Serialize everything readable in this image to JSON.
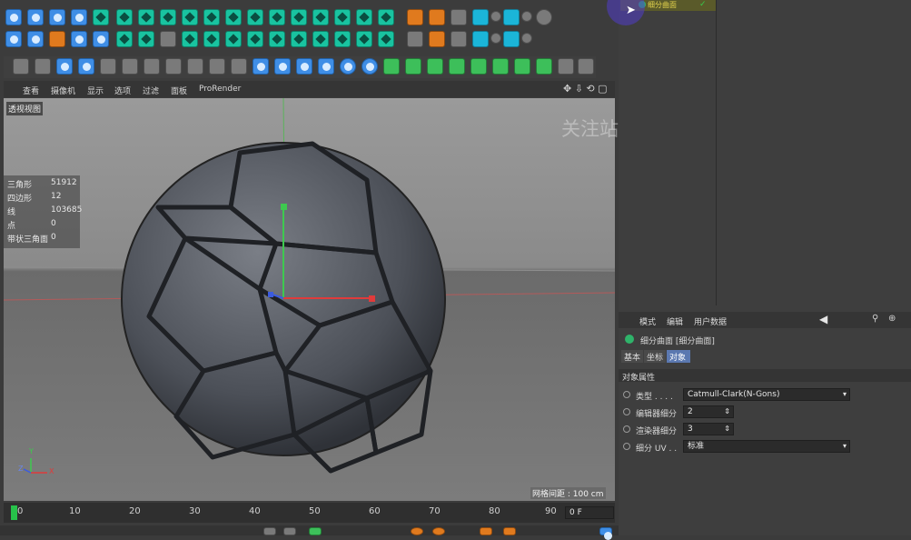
{
  "viewport_menu": [
    "查看",
    "摄像机",
    "显示",
    "选项",
    "过滤",
    "面板",
    "ProRender"
  ],
  "viewport_label": "透视视图",
  "watermark": "关注站酷/B站：尚同墨方",
  "stats": [
    {
      "label": "三角形",
      "value": "51912"
    },
    {
      "label": "四边形",
      "value": "12"
    },
    {
      "label": "线",
      "value": "103685"
    },
    {
      "label": "点",
      "value": "0"
    },
    {
      "label": "带状三角面",
      "value": "0"
    }
  ],
  "grid_spacing": "网格间距 : 100 cm",
  "axis_labels": {
    "y": "Y",
    "z": "Z",
    "x": "X"
  },
  "timeline": {
    "ticks": [
      "0",
      "10",
      "20",
      "30",
      "40",
      "50",
      "60",
      "70",
      "80",
      "90"
    ],
    "current_frame": "0 F"
  },
  "object_manager": {
    "item_name": "细分曲面"
  },
  "attributes": {
    "menu": [
      "模式",
      "编辑",
      "用户数据"
    ],
    "object_title": "细分曲面 [细分曲面]",
    "tabs": [
      "基本",
      "坐标",
      "对象"
    ],
    "section": "对象属性",
    "params": [
      {
        "label": "类型 . . . .",
        "value": "Catmull-Clark(N-Gons)"
      },
      {
        "label": "编辑器细分",
        "value": "2"
      },
      {
        "label": "渲染器细分",
        "value": "3"
      },
      {
        "label": "细分 UV . .",
        "value": "标准"
      }
    ]
  }
}
